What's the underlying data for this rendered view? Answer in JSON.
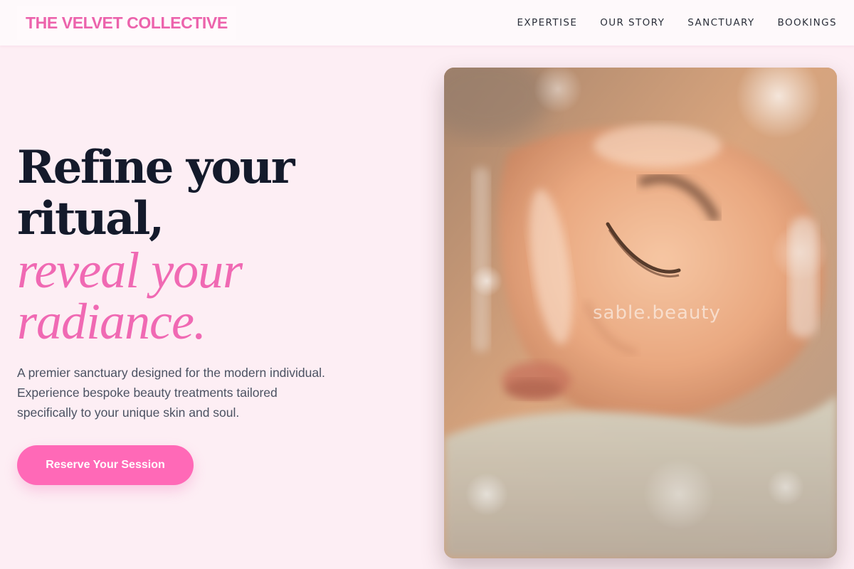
{
  "header": {
    "brand": "THE VELVET COLLECTIVE",
    "nav": [
      {
        "label": "EXPERTISE"
      },
      {
        "label": "OUR STORY"
      },
      {
        "label": "SANCTUARY"
      },
      {
        "label": "BOOKINGS"
      }
    ]
  },
  "hero": {
    "headline_line1": "Refine your",
    "headline_line2": "ritual,",
    "headline_line3": "reveal your",
    "headline_line4": "radiance.",
    "description": "A premier sanctuary designed for the modern individual. Experience bespoke beauty treatments tailored specifically to your unique skin and soul.",
    "cta_label": "Reserve Your Session",
    "image_watermark": "sable.beauty"
  },
  "colors": {
    "accent": "#f069b3",
    "button": "#ff69b7",
    "background": "#fdeef4",
    "heading": "#141a2b"
  }
}
